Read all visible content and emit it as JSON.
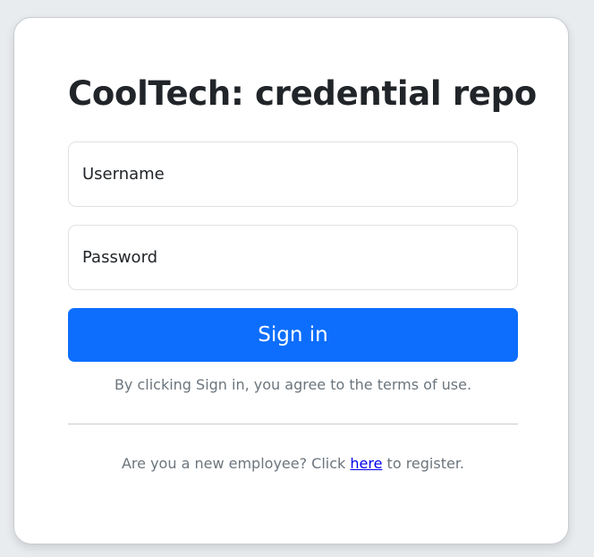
{
  "login": {
    "title": "CoolTech: credential repo",
    "username_placeholder": "Username",
    "password_placeholder": "Password",
    "signin_label": "Sign in",
    "terms_text": "By clicking Sign in, you agree to the terms of use.",
    "register_prefix": "Are you a new employee? Click ",
    "register_link": "here",
    "register_suffix": " to register."
  },
  "colors": {
    "primary": "#0d6efd",
    "background": "#e9ecef",
    "card": "#ffffff",
    "muted_text": "#6c757d",
    "heading_text": "#212529",
    "link": "#0000ee"
  }
}
